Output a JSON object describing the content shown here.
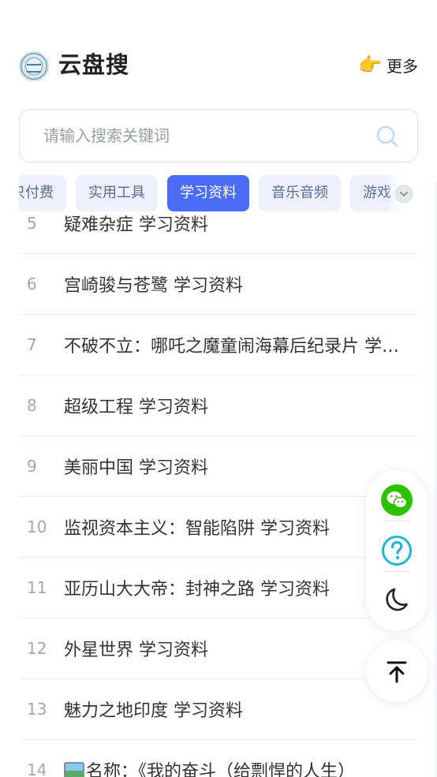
{
  "header": {
    "title": "云盘搜",
    "more_icon": "👉",
    "more_label": "更多"
  },
  "search": {
    "placeholder": "请输入搜索关键词",
    "value": ""
  },
  "tabs": [
    {
      "label": "只付费",
      "active": false
    },
    {
      "label": "实用工具",
      "active": false
    },
    {
      "label": "学习资料",
      "active": true
    },
    {
      "label": "音乐音频",
      "active": false
    },
    {
      "label": "游戏",
      "active": false
    }
  ],
  "results": [
    {
      "num": "5",
      "text": "疑难杂症 学习资料"
    },
    {
      "num": "6",
      "text": "宫崎骏与苍鹭 学习资料"
    },
    {
      "num": "7",
      "text": "不破不立：哪吒之魔童闹海幕后纪录片 学习资料"
    },
    {
      "num": "8",
      "text": "超级工程 学习资料"
    },
    {
      "num": "9",
      "text": "美丽中国 学习资料"
    },
    {
      "num": "10",
      "text": "监视资本主义：智能陷阱 学习资料"
    },
    {
      "num": "11",
      "text": "亚历山大大帝：封神之路 学习资料"
    },
    {
      "num": "12",
      "text": "外星世界 学习资料"
    },
    {
      "num": "13",
      "text": "魅力之地印度 学习资料"
    },
    {
      "num": "14",
      "text": "名称：《我的奋斗（给剽悍的人生）",
      "has_image_icon": true
    }
  ],
  "colors": {
    "accent": "#4a6cf7",
    "wechat": "#2dc100",
    "help": "#1fb6d6"
  }
}
